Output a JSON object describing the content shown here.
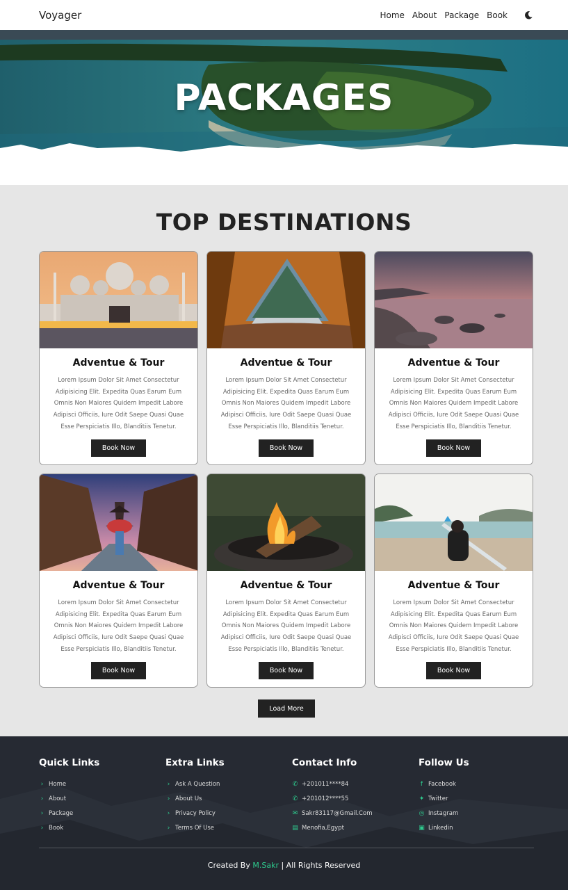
{
  "nav": {
    "brand": "Voyager",
    "links": [
      "Home",
      "About",
      "Package",
      "Book"
    ],
    "theme_icon": "moon-icon"
  },
  "hero": {
    "title": "PACKAGES"
  },
  "destinations": {
    "title": "TOP DESTINATIONS",
    "cards": [
      {
        "title": "Adventue & Tour",
        "text": "Lorem Ipsum Dolor Sit Amet Consectetur Adipisicing Elit. Expedita Quas Earum Eum Omnis Non Maiores Quidem Impedit Labore Adipisci Officiis, Iure Odit Saepe Quasi Quae Esse Perspiciatis Illo, Blanditiis Tenetur.",
        "button": "Book Now",
        "image": "mosque"
      },
      {
        "title": "Adventue & Tour",
        "text": "Lorem Ipsum Dolor Sit Amet Consectetur Adipisicing Elit. Expedita Quas Earum Eum Omnis Non Maiores Quidem Impedit Labore Adipisci Officiis, Iure Odit Saepe Quasi Quae Esse Perspiciatis Illo, Blanditiis Tenetur.",
        "button": "Book Now",
        "image": "tent"
      },
      {
        "title": "Adventue & Tour",
        "text": "Lorem Ipsum Dolor Sit Amet Consectetur Adipisicing Elit. Expedita Quas Earum Eum Omnis Non Maiores Quidem Impedit Labore Adipisci Officiis, Iure Odit Saepe Quasi Quae Esse Perspiciatis Illo, Blanditiis Tenetur.",
        "button": "Book Now",
        "image": "rocky-beach"
      },
      {
        "title": "Adventue & Tour",
        "text": "Lorem Ipsum Dolor Sit Amet Consectetur Adipisicing Elit. Expedita Quas Earum Eum Omnis Non Maiores Quidem Impedit Labore Adipisci Officiis, Iure Odit Saepe Quasi Quae Esse Perspiciatis Illo, Blanditiis Tenetur.",
        "button": "Book Now",
        "image": "kyoto-street"
      },
      {
        "title": "Adventue & Tour",
        "text": "Lorem Ipsum Dolor Sit Amet Consectetur Adipisicing Elit. Expedita Quas Earum Eum Omnis Non Maiores Quidem Impedit Labore Adipisci Officiis, Iure Odit Saepe Quasi Quae Esse Perspiciatis Illo, Blanditiis Tenetur.",
        "button": "Book Now",
        "image": "campfire"
      },
      {
        "title": "Adventue & Tour",
        "text": "Lorem Ipsum Dolor Sit Amet Consectetur Adipisicing Elit. Expedita Quas Earum Eum Omnis Non Maiores Quidem Impedit Labore Adipisci Officiis, Iure Odit Saepe Quasi Quae Esse Perspiciatis Illo, Blanditiis Tenetur.",
        "button": "Book Now",
        "image": "surfer"
      }
    ],
    "load_more": "Load More"
  },
  "footer": {
    "quick_links": {
      "title": "Quick Links",
      "items": [
        "Home",
        "About",
        "Package",
        "Book"
      ]
    },
    "extra_links": {
      "title": "Extra Links",
      "items": [
        "Ask A Question",
        "About Us",
        "Privacy Policy",
        "Terms Of Use"
      ]
    },
    "contact": {
      "title": "Contact Info",
      "items": [
        "+201011****84",
        "+201012****55",
        "Sakr83117@Gmail.Com",
        "Menofia,Egypt"
      ]
    },
    "follow": {
      "title": "Follow Us",
      "items": [
        "Facebook",
        "Twitter",
        "Instagram",
        "Linkedin"
      ]
    },
    "credit_prefix": "Created By",
    "credit_name": "M.Sakr",
    "credit_suffix": "| All Rights Reserved",
    "accent_color": "#2ecc8f"
  }
}
